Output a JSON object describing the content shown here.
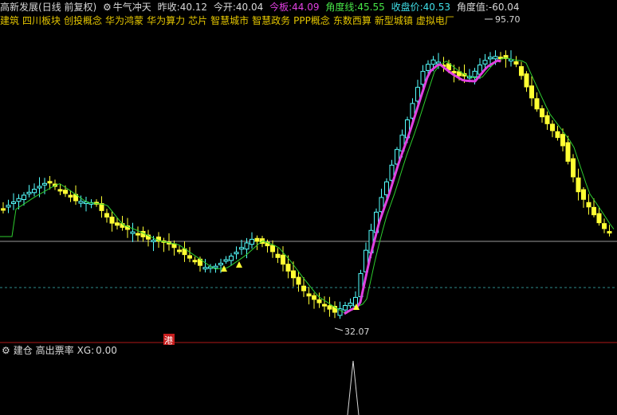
{
  "header": {
    "security_name": "高新发展",
    "period_label": "(日线 前复权)",
    "indicator_name": "牛气冲天",
    "stats": [
      {
        "label": "昨收:",
        "value": "40.12",
        "color": "#d8d8d8"
      },
      {
        "label": "今开:",
        "value": "40.04",
        "color": "#d8d8d8"
      },
      {
        "label": "今板:",
        "value": "44.09",
        "color": "#e040e0"
      },
      {
        "label": "角度线:",
        "value": "45.55",
        "color": "#48e848"
      },
      {
        "label": "收盘价:",
        "value": "40.53",
        "color": "#40e0e8"
      },
      {
        "label": "角度值:",
        "value": "-60.04",
        "color": "#d8d8d8"
      }
    ]
  },
  "concepts": [
    "建筑",
    "四川板块",
    "创投概念",
    "华为鸿蒙",
    "华为算力",
    "芯片",
    "智慧城市",
    "智慧政务",
    "PPP概念",
    "东数西算",
    "新型城镇",
    "虚拟电厂"
  ],
  "price_labels": {
    "high": "95.70",
    "low": "32.07"
  },
  "hk_marker": "港",
  "sub_panel": {
    "name": "建仓 高出票率",
    "indicator": "XG:",
    "value": "0.00"
  },
  "colors": {
    "up": "#54ffff",
    "down": "#ffff33",
    "ma": "#2ecc2e",
    "trend": "#e040e0",
    "text": "#d8d8d8",
    "concept": "#e5c600",
    "hk_marker_bg": "#c81e1e"
  }
}
